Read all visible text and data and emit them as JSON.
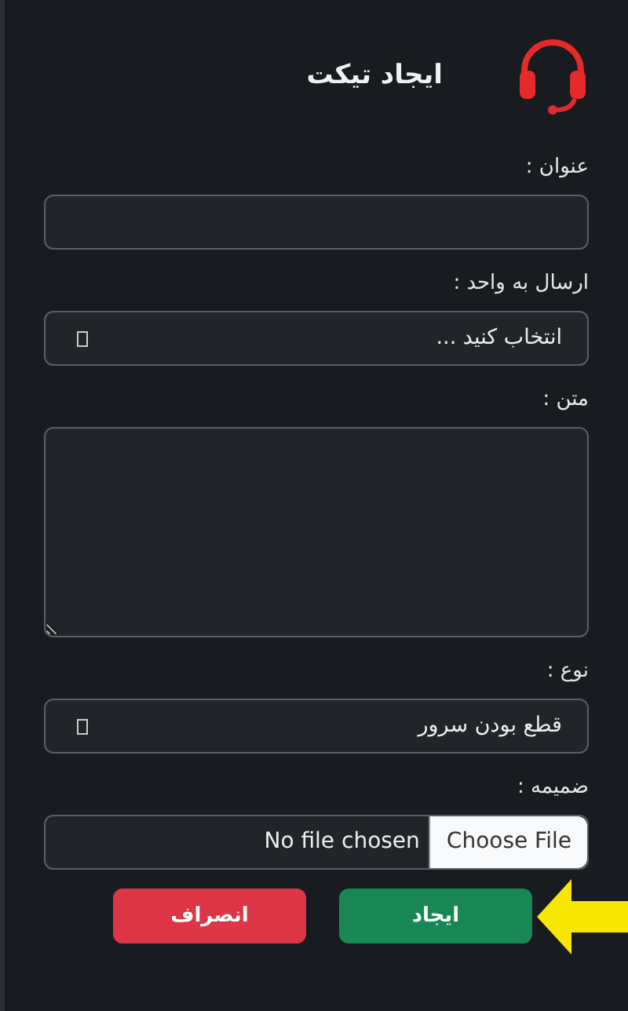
{
  "header": {
    "title": "ایجاد تیکت"
  },
  "fields": [
    {
      "kind": "text",
      "label": "عنوان :"
    },
    {
      "kind": "select",
      "label": "ارسال به واحد :",
      "value": "انتخاب کنید ..."
    },
    {
      "kind": "textarea",
      "label": "متن :"
    },
    {
      "kind": "select",
      "label": "نوع :",
      "value": "قطع بودن سرور"
    },
    {
      "kind": "file",
      "label": "ضمیمه :",
      "button": "Choose File",
      "status": "No file chosen"
    }
  ],
  "buttons": [
    {
      "kind": "submit",
      "label": "ایجاد",
      "highlighted": true
    },
    {
      "kind": "cancel",
      "label": "انصراف",
      "highlighted": false
    }
  ]
}
